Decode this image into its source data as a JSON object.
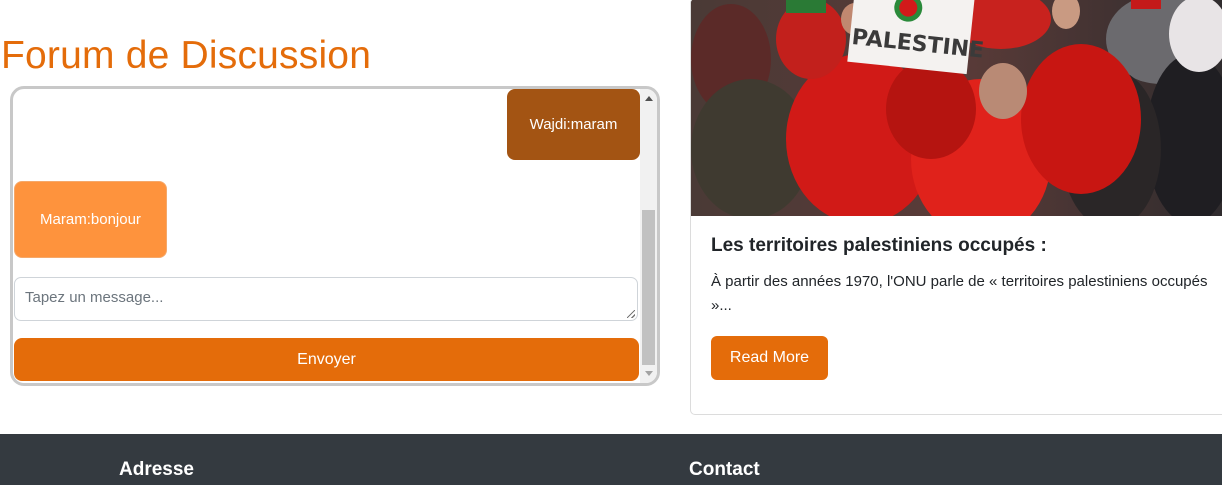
{
  "forum": {
    "title": "Forum de Discussion",
    "messages": [
      {
        "text": "Wajdi:maram",
        "side": "right",
        "color": "#a35413"
      },
      {
        "text": "Maram:bonjour",
        "side": "left",
        "color": "#fe933d"
      }
    ],
    "input_placeholder": "Tapez un message...",
    "send_label": "Envoyer"
  },
  "card": {
    "image_sign_text": "PALESTINE",
    "title": "Les territoires palestiniens occupés :",
    "text": "À partir des années 1970, l'ONU parle de « territoires palestiniens occupés »...",
    "button_label": "Read More"
  },
  "footer": {
    "address_heading": "Adresse",
    "contact_heading": "Contact"
  },
  "colors": {
    "accent": "#e46c0a",
    "footer_bg": "#343a40"
  }
}
